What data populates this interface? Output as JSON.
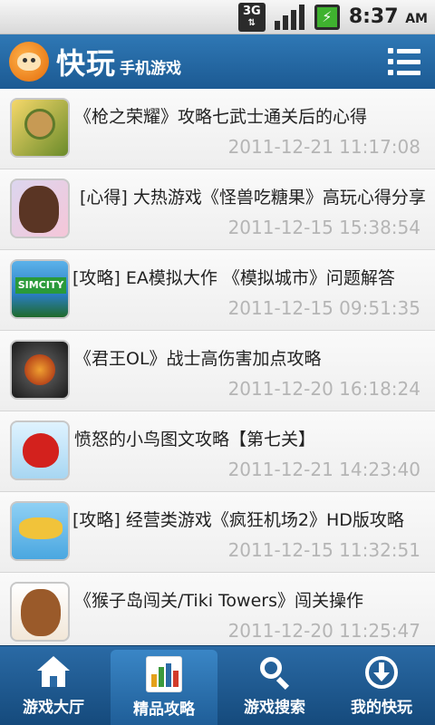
{
  "status_bar": {
    "network": "3G",
    "time": "8:37",
    "ampm": "AM"
  },
  "header": {
    "title": "快玩",
    "subtitle": "手机游戏"
  },
  "articles": [
    {
      "title": "《枪之荣耀》攻略七武士通关后的心得",
      "date": "2011-12-21 11:17:08"
    },
    {
      "title": "[心得] 大热游戏《怪兽吃糖果》高玩心得分享",
      "date": "2011-12-15 15:38:54"
    },
    {
      "title": "[攻略] EA模拟大作 《模拟城市》问题解答",
      "date": "2011-12-15 09:51:35"
    },
    {
      "title": "《君王OL》战士高伤害加点攻略",
      "date": "2011-12-20 16:18:24"
    },
    {
      "title": "愤怒的小鸟图文攻略【第七关】",
      "date": "2011-12-21 14:23:40"
    },
    {
      "title": "[攻略] 经营类游戏《疯狂机场2》HD版攻略",
      "date": "2011-12-15 11:32:51"
    },
    {
      "title": "《猴子岛闯关/Tiki Towers》闯关操作",
      "date": "2011-12-20 11:25:47"
    }
  ],
  "thumb_texts": {
    "simcity": "SIMCITY"
  },
  "tabs": [
    {
      "label": "游戏大厅",
      "icon": "home-icon"
    },
    {
      "label": "精品攻略",
      "icon": "chart-icon",
      "active": true
    },
    {
      "label": "游戏搜索",
      "icon": "search-icon"
    },
    {
      "label": "我的快玩",
      "icon": "download-icon"
    }
  ],
  "colors": {
    "header": "#1c5a93",
    "tab_bar": "#154a7c",
    "date_text": "#b5b5b5"
  }
}
